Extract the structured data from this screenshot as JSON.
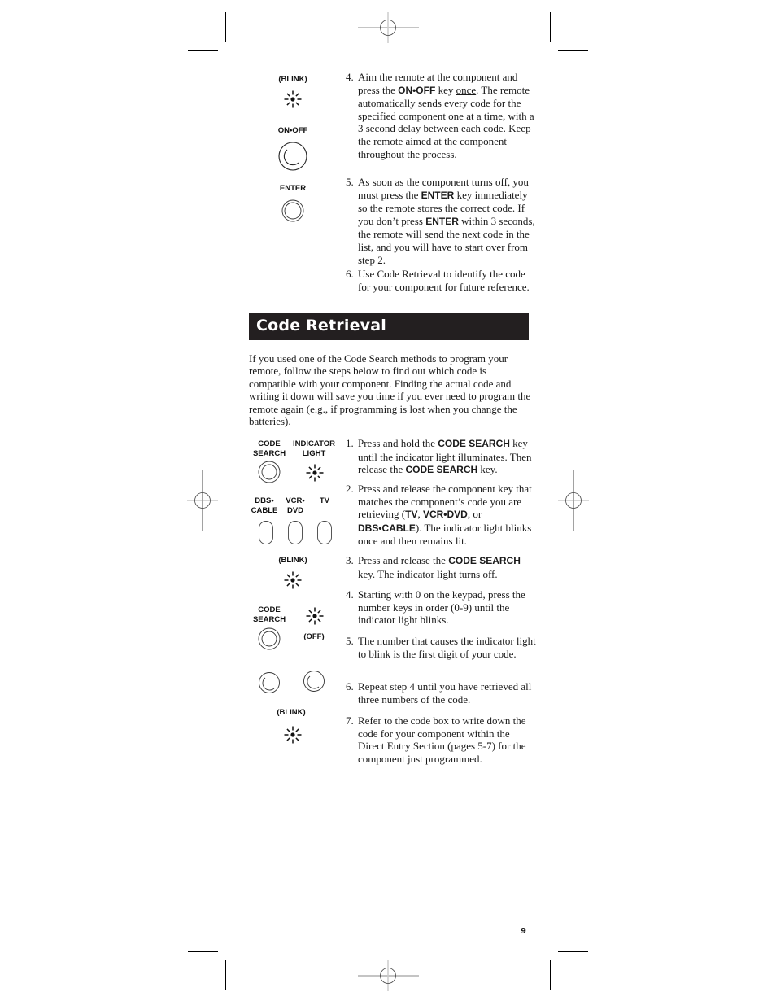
{
  "page": {
    "page_number": "9"
  },
  "top_section": {
    "illustrations": {
      "blink_label": "(BLINK)",
      "onoff_label": "ON•OFF",
      "enter_label": "ENTER"
    },
    "steps": [
      {
        "number": "4.",
        "parts": [
          "Aim the remote at the component and press the ",
          "ON•OFF",
          " key ",
          "once",
          ". The remote automatically sends every code for the specified component one at a time, with a 3 second delay between each code. Keep the remote aimed at the component throughout the process."
        ]
      },
      {
        "number": "5.",
        "parts": [
          "As soon as the component turns off, you must press the ",
          "ENTER",
          " key immediately so the remote stores the correct code. If you don’t press ",
          "ENTER",
          " within 3 seconds, the remote will send the next code in the list, and you will have to start over from step 2."
        ]
      },
      {
        "number": "6.",
        "parts": [
          "Use Code Retrieval to identify the code for your component for future reference."
        ]
      }
    ]
  },
  "section": {
    "title": "Code Retrieval",
    "intro": "If you used one of the Code Search methods to program your remote, follow the steps below to find out which code is compatible with your component. Finding the actual code and writing it down will save you time if you ever need to program the remote again (e.g., if programming is lost when you change the batteries).",
    "illustrations": {
      "code_search_label_1": "CODE",
      "code_search_label_2": "SEARCH",
      "indicator_label_1": "INDICATOR",
      "indicator_label_2": "LIGHT",
      "dbs_label_1": "DBS•",
      "dbs_label_2": "CABLE",
      "vcr_label_1": "VCR•",
      "vcr_label_2": "DVD",
      "tv_label": "TV",
      "blink_label_1": "(BLINK)",
      "code_search2_label_1": "CODE",
      "code_search2_label_2": "SEARCH",
      "off_label": "(OFF)",
      "blink_label_2": "(BLINK)"
    },
    "steps": [
      {
        "number": "1.",
        "parts": [
          "Press and hold the ",
          "CODE SEARCH",
          " key until the indicator light illuminates. Then release the ",
          "CODE SEARCH",
          " key."
        ]
      },
      {
        "number": "2.",
        "parts": [
          "Press and release the component key that matches the component’s code you are retrieving (",
          "TV",
          ", ",
          "VCR•DVD",
          ", or ",
          "DBS•CABLE",
          "). The indicator light blinks once and then remains lit."
        ]
      },
      {
        "number": "3.",
        "parts": [
          "Press and release the ",
          "CODE SEARCH",
          " key. The indicator light turns off."
        ]
      },
      {
        "number": "4.",
        "text": "Starting with 0 on the keypad, press the number keys in order (0-9) until the indicator light blinks."
      },
      {
        "number": "5.",
        "text": "The number that causes the indicator light to blink is the first digit of your code."
      },
      {
        "number": "6.",
        "text": "Repeat step 4 until you have retrieved all three numbers of the code."
      },
      {
        "number": "7.",
        "text": "Refer to the code box to write down the code for your component within the Direct Entry Section (pages 5-7) for the component just programmed."
      }
    ]
  }
}
